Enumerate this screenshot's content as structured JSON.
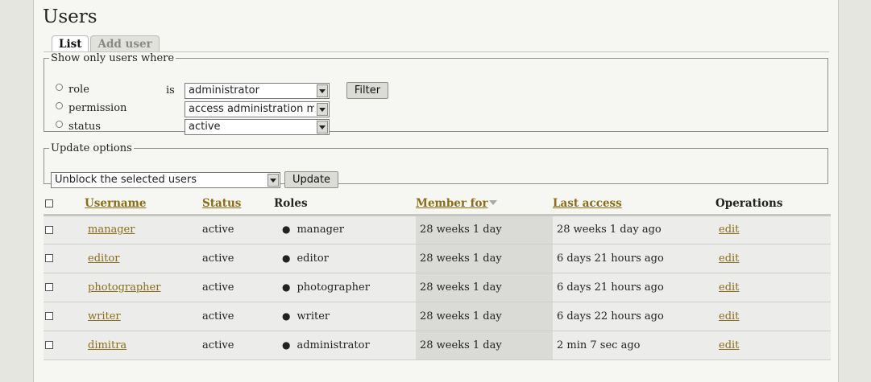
{
  "page": {
    "title": "Users"
  },
  "tabs": [
    {
      "label": "List"
    },
    {
      "label": "Add user"
    }
  ],
  "filter": {
    "legend": "Show only users where",
    "options": [
      {
        "label": "role",
        "value": "administrator"
      },
      {
        "label": "permission",
        "value": "access administration menu"
      },
      {
        "label": "status",
        "value": "active"
      }
    ],
    "is_label": "is",
    "button_label": "Filter"
  },
  "update": {
    "legend": "Update options",
    "selected": "Unblock the selected users",
    "button_label": "Update"
  },
  "table": {
    "headers": {
      "username": "Username",
      "status": "Status",
      "roles": "Roles",
      "member_for": "Member for",
      "last_access": "Last access",
      "operations": "Operations"
    },
    "rows": [
      {
        "username": "manager",
        "status": "active",
        "role": "manager",
        "member_for": "28 weeks 1 day",
        "last_access": "28 weeks 1 day ago",
        "op": "edit"
      },
      {
        "username": "editor",
        "status": "active",
        "role": "editor",
        "member_for": "28 weeks 1 day",
        "last_access": "6 days 21 hours ago",
        "op": "edit"
      },
      {
        "username": "photographer",
        "status": "active",
        "role": "photographer",
        "member_for": "28 weeks 1 day",
        "last_access": "6 days 21 hours ago",
        "op": "edit"
      },
      {
        "username": "writer",
        "status": "active",
        "role": "writer",
        "member_for": "28 weeks 1 day",
        "last_access": "6 days 22 hours ago",
        "op": "edit"
      },
      {
        "username": "dimitra",
        "status": "active",
        "role": "administrator",
        "member_for": "28 weeks 1 day",
        "last_access": "2 min 7 sec ago",
        "op": "edit"
      }
    ]
  }
}
